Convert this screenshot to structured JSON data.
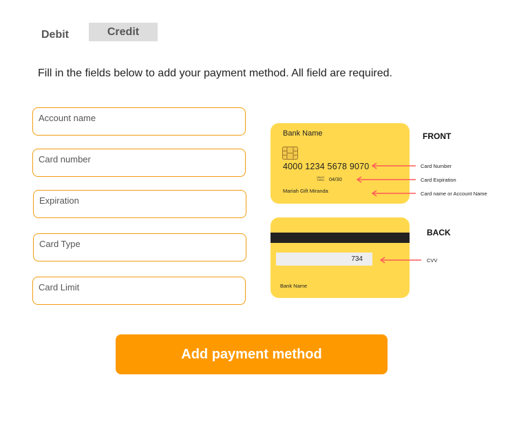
{
  "tabs": {
    "debit": "Debit",
    "credit": "Credit"
  },
  "instructions": "Fill in the fields below to add your payment method. All field are required.",
  "fields": {
    "account_name": {
      "placeholder": "Account name",
      "value": ""
    },
    "card_number": {
      "placeholder": "Card number",
      "value": ""
    },
    "expiration": {
      "placeholder": "Expiration",
      "value": ""
    },
    "card_type": {
      "placeholder": "Card Type",
      "value": ""
    },
    "card_limit": {
      "placeholder": "Card Limit",
      "value": ""
    }
  },
  "card_front": {
    "bank_name": "Bank Name",
    "number": "4000 1234 5678 9070",
    "valid_line1": "VALID",
    "valid_line2": "THRU",
    "expiry": "04/30",
    "holder": "Mariah Gift Miranda"
  },
  "card_back": {
    "cvv": "734",
    "bank_name": "Bank Name"
  },
  "labels": {
    "front": "FRONT",
    "back": "BACK"
  },
  "annotations": {
    "card_number": "Card Number",
    "card_expiration": "Card Expiration",
    "card_name": "Card name or Account Name",
    "cvv": "CVV"
  },
  "submit": "Add payment method",
  "colors": {
    "accent": "#ff9900",
    "card": "#ffd84d",
    "field_border": "#f39c12",
    "arrow": "#ff5a5a"
  }
}
